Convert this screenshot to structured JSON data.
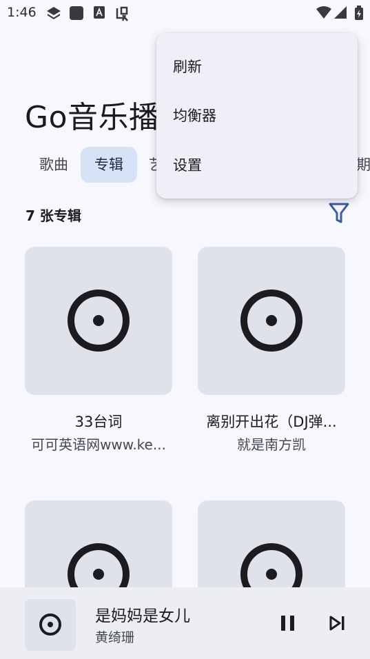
{
  "status_bar": {
    "time": "1:46",
    "left_icons": [
      "layers-icon",
      "square-app-icon",
      "font-a-icon",
      "debug-bug-icon"
    ],
    "right_icons": [
      "wifi-icon",
      "cell-signal-icon",
      "battery-charging-icon"
    ]
  },
  "header": {
    "title": "Go音乐播"
  },
  "tabs": [
    {
      "label": "歌曲",
      "selected": false
    },
    {
      "label": "专辑",
      "selected": true
    },
    {
      "label": "艺",
      "selected": false
    },
    {
      "label": "期",
      "selected": false
    }
  ],
  "album_count": "7 张专辑",
  "albums": [
    {
      "title": "33台词",
      "artist": "可可英语网www.ke..."
    },
    {
      "title": "离别开出花（DJ弹...",
      "artist": "就是南方凯"
    },
    {
      "title": "",
      "artist": ""
    },
    {
      "title": "",
      "artist": ""
    }
  ],
  "menu": {
    "items": [
      {
        "label": "刷新"
      },
      {
        "label": "均衡器"
      },
      {
        "label": "设置"
      }
    ]
  },
  "now_playing": {
    "title": "是妈妈是女儿",
    "artist": "黄绮珊",
    "state": "playing"
  },
  "colors": {
    "background": "#f7f8fd",
    "tab_selected_bg": "#d8e2f7",
    "filter_accent": "#3a5ba8",
    "album_art_bg": "#dfe2ea",
    "menu_bg": "#eff0f7",
    "player_bg": "#eceef4"
  }
}
